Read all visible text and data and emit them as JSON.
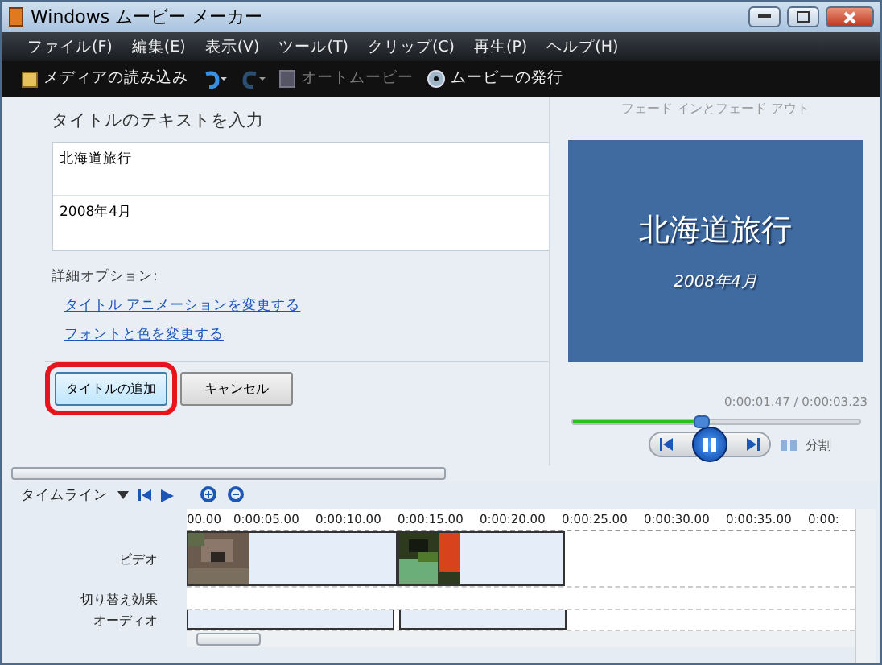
{
  "window": {
    "title": "Windows ムービー メーカー"
  },
  "menu": [
    "ファイル(F)",
    "編集(E)",
    "表示(V)",
    "ツール(T)",
    "クリップ(C)",
    "再生(P)",
    "ヘルプ(H)"
  ],
  "toolbar": [
    {
      "kind": "import",
      "label": "メディアの読み込み",
      "disabled": false
    },
    {
      "kind": "undo",
      "disabled": false
    },
    {
      "kind": "redo",
      "disabled": true
    },
    {
      "kind": "automovie",
      "label": "オートムービー",
      "disabled": true
    },
    {
      "kind": "publish",
      "label": "ムービーの発行",
      "disabled": false
    }
  ],
  "title_panel": {
    "heading": "タイトルのテキストを入力",
    "lines": [
      "北海道旅行",
      "2008年4月"
    ],
    "options_label": "詳細オプション:",
    "links": [
      "タイトル アニメーションを変更する",
      "フォントと色を変更する"
    ],
    "buttons": [
      {
        "label": "タイトルの追加",
        "highlighted": true
      },
      {
        "label": "キャンセル",
        "highlighted": false
      }
    ]
  },
  "preview": {
    "effect": "フェード インとフェード アウト",
    "title": "北海道旅行",
    "subtitle": "2008年4月",
    "time": "0:00:01.47 / 0:00:03.23",
    "level": 0.45,
    "split": "分割"
  },
  "timeline": {
    "label": "タイムライン",
    "ruler": [
      "00.00",
      "0:00:05.00",
      "0:00:10.00",
      "0:00:15.00",
      "0:00:20.00",
      "0:00:25.00",
      "0:00:30.00",
      "0:00:35.00",
      "0:00:"
    ],
    "tracks": [
      {
        "kind": "video",
        "label": "ビデオ"
      },
      {
        "kind": "transition",
        "label": "切り替え効果"
      },
      {
        "kind": "audio",
        "label": "オーディオ"
      }
    ]
  }
}
